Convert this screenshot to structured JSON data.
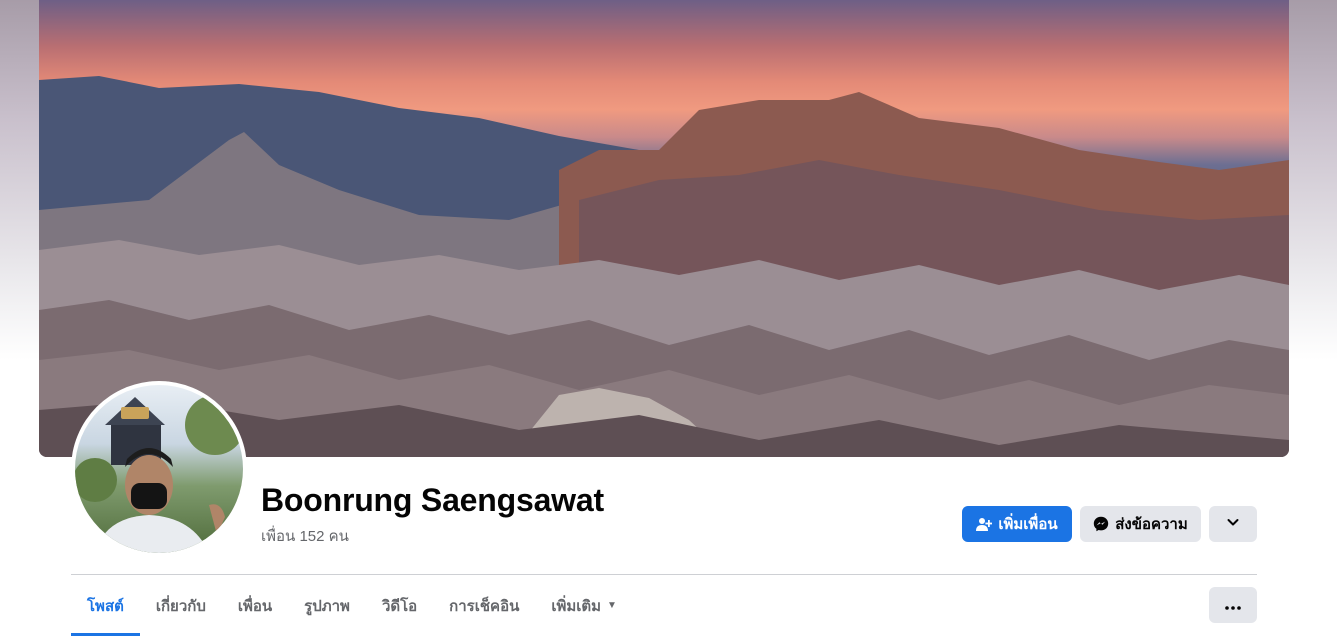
{
  "profile": {
    "name": "Boonrung Saengsawat",
    "friends_count": "เพื่อน 152 คน"
  },
  "actions": {
    "add_friend_label": "เพิ่มเพื่อน",
    "message_label": "ส่งข้อความ"
  },
  "tabs": [
    {
      "label": "โพสต์",
      "active": true
    },
    {
      "label": "เกี่ยวกับ",
      "active": false
    },
    {
      "label": "เพื่อน",
      "active": false
    },
    {
      "label": "รูปภาพ",
      "active": false
    },
    {
      "label": "วิดีโอ",
      "active": false
    },
    {
      "label": "การเช็คอิน",
      "active": false
    },
    {
      "label": "เพิ่มเติม",
      "active": false
    }
  ],
  "colors": {
    "accent": "#1b74e4",
    "secondary_button": "#e4e6eb",
    "text_primary": "#050505",
    "text_secondary": "#65676b"
  },
  "icons": {
    "add_friend": "add-person-icon",
    "message": "messenger-icon",
    "more": "chevron-down-icon",
    "overflow": "ellipsis-icon"
  }
}
